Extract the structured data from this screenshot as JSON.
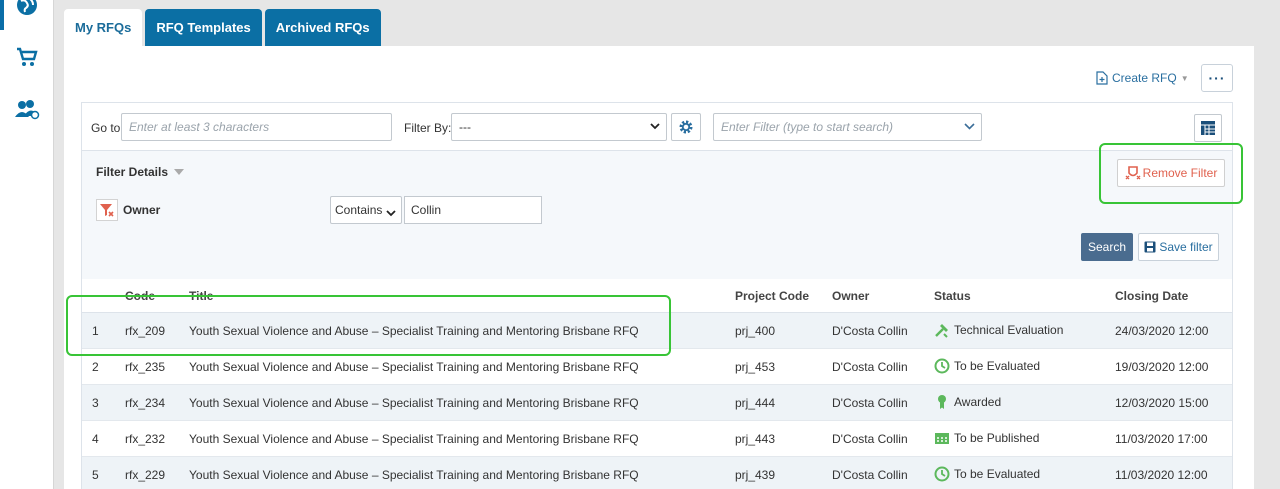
{
  "tabs": [
    {
      "label": "My RFQs"
    },
    {
      "label": "RFQ Templates"
    },
    {
      "label": "Archived RFQs"
    }
  ],
  "header": {
    "create_rfq": "Create RFQ",
    "more": "···"
  },
  "toolbar": {
    "goto_label": "Go to",
    "goto_placeholder": "Enter at least 3 characters",
    "filter_by_label": "Filter By:",
    "filter_by_value": "---",
    "enter_filter_placeholder": "Enter Filter (type to start search)"
  },
  "filter": {
    "details_label": "Filter Details",
    "field_label": "Owner",
    "operator": "Contains",
    "value": "Collin",
    "remove_label": "Remove Filter",
    "search_label": "Search",
    "save_label": "Save filter"
  },
  "grid": {
    "columns": [
      "Code",
      "Title",
      "Project Code",
      "Owner",
      "Status",
      "Closing Date"
    ],
    "rows": [
      {
        "num": "1",
        "code": "rfx_209",
        "title": "Youth Sexual Violence and Abuse – Specialist Training and Mentoring Brisbane RFQ",
        "project": "prj_400",
        "owner": "D'Costa Collin",
        "status": "Technical Evaluation",
        "status_icon": "evaluation-icon",
        "closing": "24/03/2020 12:00"
      },
      {
        "num": "2",
        "code": "rfx_235",
        "title": "Youth Sexual Violence and Abuse – Specialist Training and Mentoring Brisbane RFQ",
        "project": "prj_453",
        "owner": "D'Costa Collin",
        "status": "To be Evaluated",
        "status_icon": "clock-icon",
        "closing": "19/03/2020 12:00"
      },
      {
        "num": "3",
        "code": "rfx_234",
        "title": "Youth Sexual Violence and Abuse – Specialist Training and Mentoring Brisbane RFQ",
        "project": "prj_444",
        "owner": "D'Costa Collin",
        "status": "Awarded",
        "status_icon": "award-icon",
        "closing": "12/03/2020 15:00"
      },
      {
        "num": "4",
        "code": "rfx_232",
        "title": "Youth Sexual Violence and Abuse – Specialist Training and Mentoring Brisbane RFQ",
        "project": "prj_443",
        "owner": "D'Costa Collin",
        "status": "To be Published",
        "status_icon": "calendar-icon",
        "closing": "11/03/2020 17:00"
      },
      {
        "num": "5",
        "code": "rfx_229",
        "title": "Youth Sexual Violence and Abuse – Specialist Training and Mentoring Brisbane RFQ",
        "project": "prj_439",
        "owner": "D'Costa Collin",
        "status": "To be Evaluated",
        "status_icon": "clock-icon",
        "closing": "11/03/2020 12:00"
      }
    ]
  },
  "colors": {
    "accent": "#0b6fa4",
    "highlight": "#38c436",
    "status_green": "#5cb85c",
    "remove": "#e0614e"
  }
}
